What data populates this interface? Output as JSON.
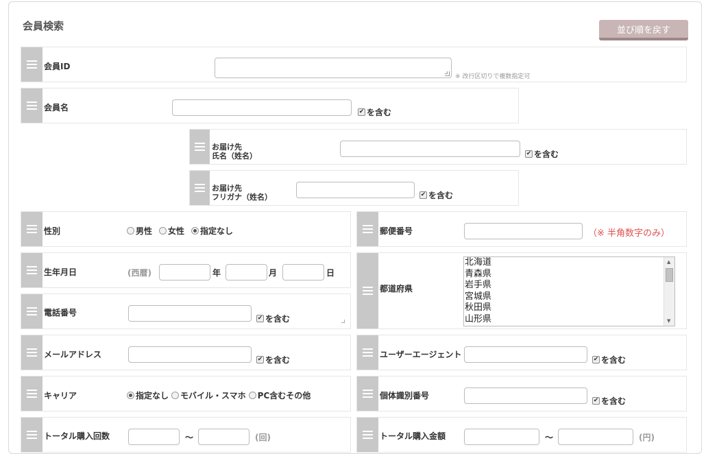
{
  "header": {
    "title": "会員検索",
    "reset_button": "並び順を戻す"
  },
  "fields": {
    "member_id": {
      "label": "会員ID",
      "note": "※ 改行区切りで複数指定可"
    },
    "member_name": {
      "label": "会員名",
      "contains": "を含む"
    },
    "delivery_name": {
      "label_line1": "お届け先",
      "label_line2": "氏名（姓名）",
      "contains": "を含む"
    },
    "delivery_kana": {
      "label_line1": "お届け先",
      "label_line2": "フリガナ（姓名）",
      "contains": "を含む"
    },
    "gender": {
      "label": "性別",
      "options": [
        "男性",
        "女性",
        "指定なし"
      ],
      "selected": "指定なし"
    },
    "postal_code": {
      "label": "郵便番号",
      "note": "（※ 半角数字のみ）"
    },
    "birthday": {
      "label": "生年月日",
      "era": "(西暦)",
      "year": "年",
      "month": "月",
      "day": "日"
    },
    "prefecture": {
      "label": "都道府県",
      "options": [
        "北海道",
        "青森県",
        "岩手県",
        "宮城県",
        "秋田県",
        "山形県"
      ]
    },
    "phone": {
      "label": "電話番号",
      "contains": "を含む"
    },
    "email": {
      "label": "メールアドレス",
      "contains": "を含む"
    },
    "user_agent": {
      "label": "ユーザーエージェント",
      "contains": "を含む"
    },
    "carrier": {
      "label": "キャリア",
      "options": [
        "指定なし",
        "モバイル・スマホ",
        "PC含むその他"
      ],
      "selected": "指定なし"
    },
    "device_id": {
      "label": "個体識別番号",
      "contains": "を含む"
    },
    "total_purchases": {
      "label": "トータル購入回数",
      "tilde": "～",
      "unit": "(回)"
    },
    "total_amount": {
      "label": "トータル購入金額",
      "tilde": "～",
      "unit": "(円)"
    }
  },
  "checkbox_mark": "✔",
  "icons": {
    "handle": "drag-handle-icon",
    "resize": "resize-grip-icon"
  }
}
